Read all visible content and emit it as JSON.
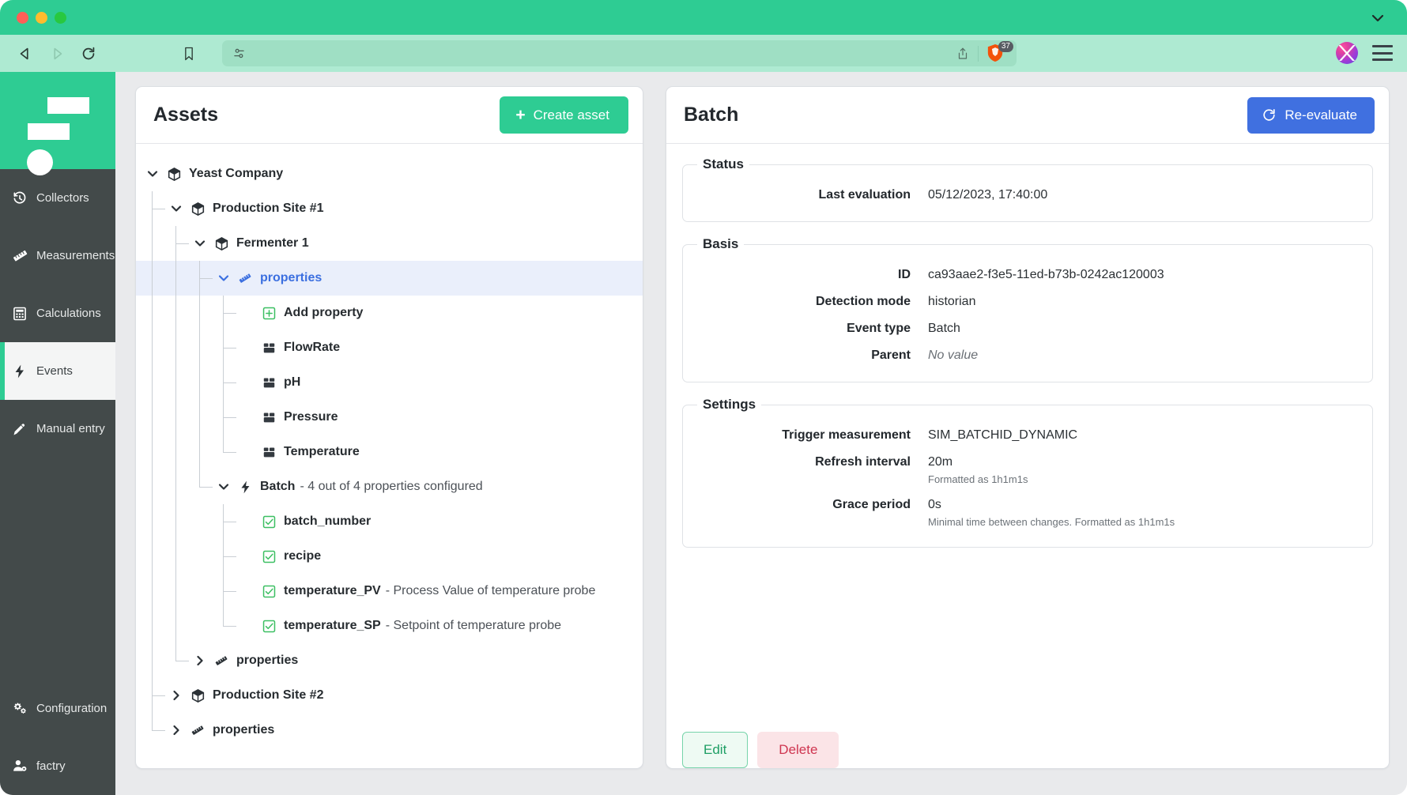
{
  "browser": {
    "back_icon": "back-arrow-icon",
    "forward_icon": "forward-arrow-icon",
    "reload_icon": "reload-icon",
    "bookmark_icon": "bookmark-icon",
    "url_value": "",
    "url_placeholder": "",
    "url_left_icon": "site-settings-icon",
    "share_icon": "share-icon",
    "shield_icon": "brave-shield-icon",
    "shield_count": "37",
    "avatar_icon": "profile-avatar",
    "menu_icon": "hamburger-menu-icon",
    "chevron_icon": "chevron-down-icon"
  },
  "sidebar": {
    "logo": "factry-logo",
    "items": [
      {
        "label": "Collectors",
        "icon": "history-clock-icon",
        "active": false
      },
      {
        "label": "Measurements",
        "icon": "ruler-icon",
        "active": false
      },
      {
        "label": "Calculations",
        "icon": "calculator-icon",
        "active": false
      },
      {
        "label": "Events",
        "icon": "lightning-bolt-icon",
        "active": true
      },
      {
        "label": "Manual entry",
        "icon": "pencil-icon",
        "active": false
      }
    ],
    "bottom_items": [
      {
        "label": "Configuration",
        "icon": "gears-icon"
      },
      {
        "label": "factry",
        "icon": "user-gear-icon"
      }
    ]
  },
  "assets_panel": {
    "title": "Assets",
    "create_button": "Create asset",
    "create_icon": "plus-icon",
    "tree": [
      {
        "label": "Yeast Company",
        "sub": "",
        "depth": 0,
        "icon": "cube-icon",
        "caret": "down",
        "selected": false
      },
      {
        "label": "Production Site #1",
        "sub": "",
        "depth": 1,
        "icon": "cube-icon",
        "caret": "down",
        "selected": false
      },
      {
        "label": "Fermenter 1",
        "sub": "",
        "depth": 2,
        "icon": "cube-icon",
        "caret": "down",
        "selected": false
      },
      {
        "label": "properties",
        "sub": "",
        "depth": 3,
        "icon": "ruler-icon",
        "caret": "down",
        "selected": true
      },
      {
        "label": "Add property",
        "sub": "",
        "depth": 4,
        "icon": "plus-box-icon",
        "caret": "none",
        "selected": false
      },
      {
        "label": "FlowRate",
        "sub": "",
        "depth": 4,
        "icon": "measurement-icon",
        "caret": "none",
        "selected": false
      },
      {
        "label": "pH",
        "sub": "",
        "depth": 4,
        "icon": "measurement-icon",
        "caret": "none",
        "selected": false
      },
      {
        "label": "Pressure",
        "sub": "",
        "depth": 4,
        "icon": "measurement-icon",
        "caret": "none",
        "selected": false
      },
      {
        "label": "Temperature",
        "sub": "",
        "depth": 4,
        "icon": "measurement-icon",
        "caret": "none",
        "selected": false
      },
      {
        "label": "Batch",
        "sub": "- 4 out of 4 properties configured",
        "depth": 3,
        "icon": "lightning-bolt-icon",
        "caret": "down",
        "selected": false
      },
      {
        "label": "batch_number",
        "sub": "",
        "depth": 4,
        "icon": "check-box-icon",
        "caret": "none",
        "selected": false
      },
      {
        "label": "recipe",
        "sub": "",
        "depth": 4,
        "icon": "check-box-icon",
        "caret": "none",
        "selected": false
      },
      {
        "label": "temperature_PV",
        "sub": "- Process Value of temperature probe",
        "depth": 4,
        "icon": "check-box-icon",
        "caret": "none",
        "selected": false
      },
      {
        "label": "temperature_SP",
        "sub": "- Setpoint of temperature probe",
        "depth": 4,
        "icon": "check-box-icon",
        "caret": "none",
        "selected": false
      },
      {
        "label": "properties",
        "sub": "",
        "depth": 2,
        "icon": "ruler-icon",
        "caret": "right",
        "selected": false
      },
      {
        "label": "Production Site #2",
        "sub": "",
        "depth": 1,
        "icon": "cube-icon",
        "caret": "right",
        "selected": false
      },
      {
        "label": "properties",
        "sub": "",
        "depth": 1,
        "icon": "ruler-icon",
        "caret": "right",
        "selected": false
      }
    ]
  },
  "detail_panel": {
    "title": "Batch",
    "reevaluate_button": "Re-evaluate",
    "reevaluate_icon": "refresh-icon",
    "status": {
      "legend": "Status",
      "rows": [
        {
          "label": "Last evaluation",
          "value": "05/12/2023, 17:40:00",
          "hint": "",
          "muted": false
        }
      ]
    },
    "basis": {
      "legend": "Basis",
      "rows": [
        {
          "label": "ID",
          "value": "ca93aae2-f3e5-11ed-b73b-0242ac120003",
          "hint": "",
          "muted": false
        },
        {
          "label": "Detection mode",
          "value": "historian",
          "hint": "",
          "muted": false
        },
        {
          "label": "Event type",
          "value": "Batch",
          "hint": "",
          "muted": false
        },
        {
          "label": "Parent",
          "value": "No value",
          "hint": "",
          "muted": true
        }
      ]
    },
    "settings": {
      "legend": "Settings",
      "rows": [
        {
          "label": "Trigger measurement",
          "value": "SIM_BATCHID_DYNAMIC",
          "hint": "",
          "muted": false
        },
        {
          "label": "Refresh interval",
          "value": "20m",
          "hint": "Formatted as 1h1m1s",
          "muted": false
        },
        {
          "label": "Grace period",
          "value": "0s",
          "hint": "Minimal time between changes. Formatted as 1h1m1s",
          "muted": false
        }
      ]
    },
    "edit_button": "Edit",
    "delete_button": "Delete"
  },
  "colors": {
    "brand_green": "#2ecc93",
    "accent_blue": "#4070e0",
    "selected_row": "#eaeffb",
    "sidebar_bg": "#434a4a",
    "page_bg": "#e9eaec"
  }
}
